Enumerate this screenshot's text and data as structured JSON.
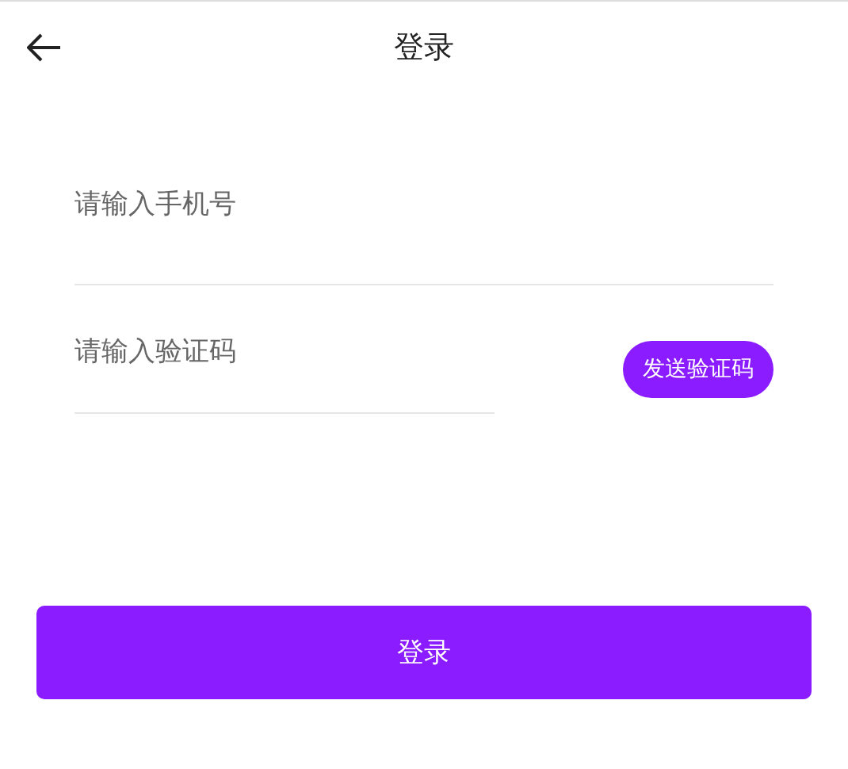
{
  "header": {
    "title": "登录"
  },
  "phone_field": {
    "placeholder": "请输入手机号"
  },
  "code_field": {
    "placeholder": "请输入验证码"
  },
  "send_code_button": {
    "label": "发送验证码"
  },
  "login_button": {
    "label": "登录"
  }
}
